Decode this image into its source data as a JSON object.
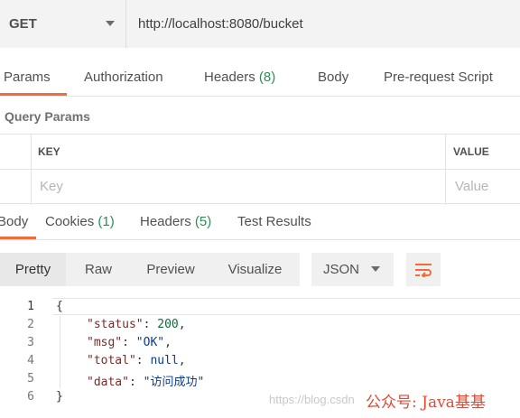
{
  "request": {
    "method": "GET",
    "url": "http://localhost:8080/bucket"
  },
  "request_tabs": [
    {
      "label": "Params",
      "count": ""
    },
    {
      "label": "Authorization",
      "count": ""
    },
    {
      "label": "Headers",
      "count": "(8)"
    },
    {
      "label": "Body",
      "count": ""
    },
    {
      "label": "Pre-request Script",
      "count": ""
    }
  ],
  "query_params": {
    "title": "Query Params",
    "columns": [
      "KEY",
      "VALUE"
    ],
    "placeholders": {
      "key": "Key",
      "value": "Value"
    }
  },
  "response_tabs": [
    {
      "label": "Body",
      "count": ""
    },
    {
      "label": "Cookies",
      "count": "(1)"
    },
    {
      "label": "Headers",
      "count": "(5)"
    },
    {
      "label": "Test Results",
      "count": ""
    }
  ],
  "response_toolbar": {
    "views": [
      "Pretty",
      "Raw",
      "Preview",
      "Visualize"
    ],
    "active_view": "Pretty",
    "format": "JSON",
    "wrap_icon": "wrap-lines-icon"
  },
  "response_body": {
    "line_numbers": [
      "1",
      "2",
      "3",
      "4",
      "5",
      "6"
    ],
    "lines": [
      {
        "open": "{"
      },
      {
        "key": "\"status\"",
        "sep": ": ",
        "value": "200",
        "type": "num",
        "tail": ","
      },
      {
        "key": "\"msg\"",
        "sep": ": ",
        "value": "\"OK\"",
        "type": "str",
        "tail": ","
      },
      {
        "key": "\"total\"",
        "sep": ": ",
        "value": "null",
        "type": "kw",
        "tail": ","
      },
      {
        "key": "\"data\"",
        "sep": ": ",
        "value": "\"访问成功\"",
        "type": "str",
        "tail": ""
      },
      {
        "open": "}"
      }
    ]
  },
  "watermark": {
    "url": "https://blog.csdn",
    "brand": "公众号: Java基基"
  },
  "colors": {
    "accent": "#f26b3a",
    "count_green": "#2e8b57"
  }
}
